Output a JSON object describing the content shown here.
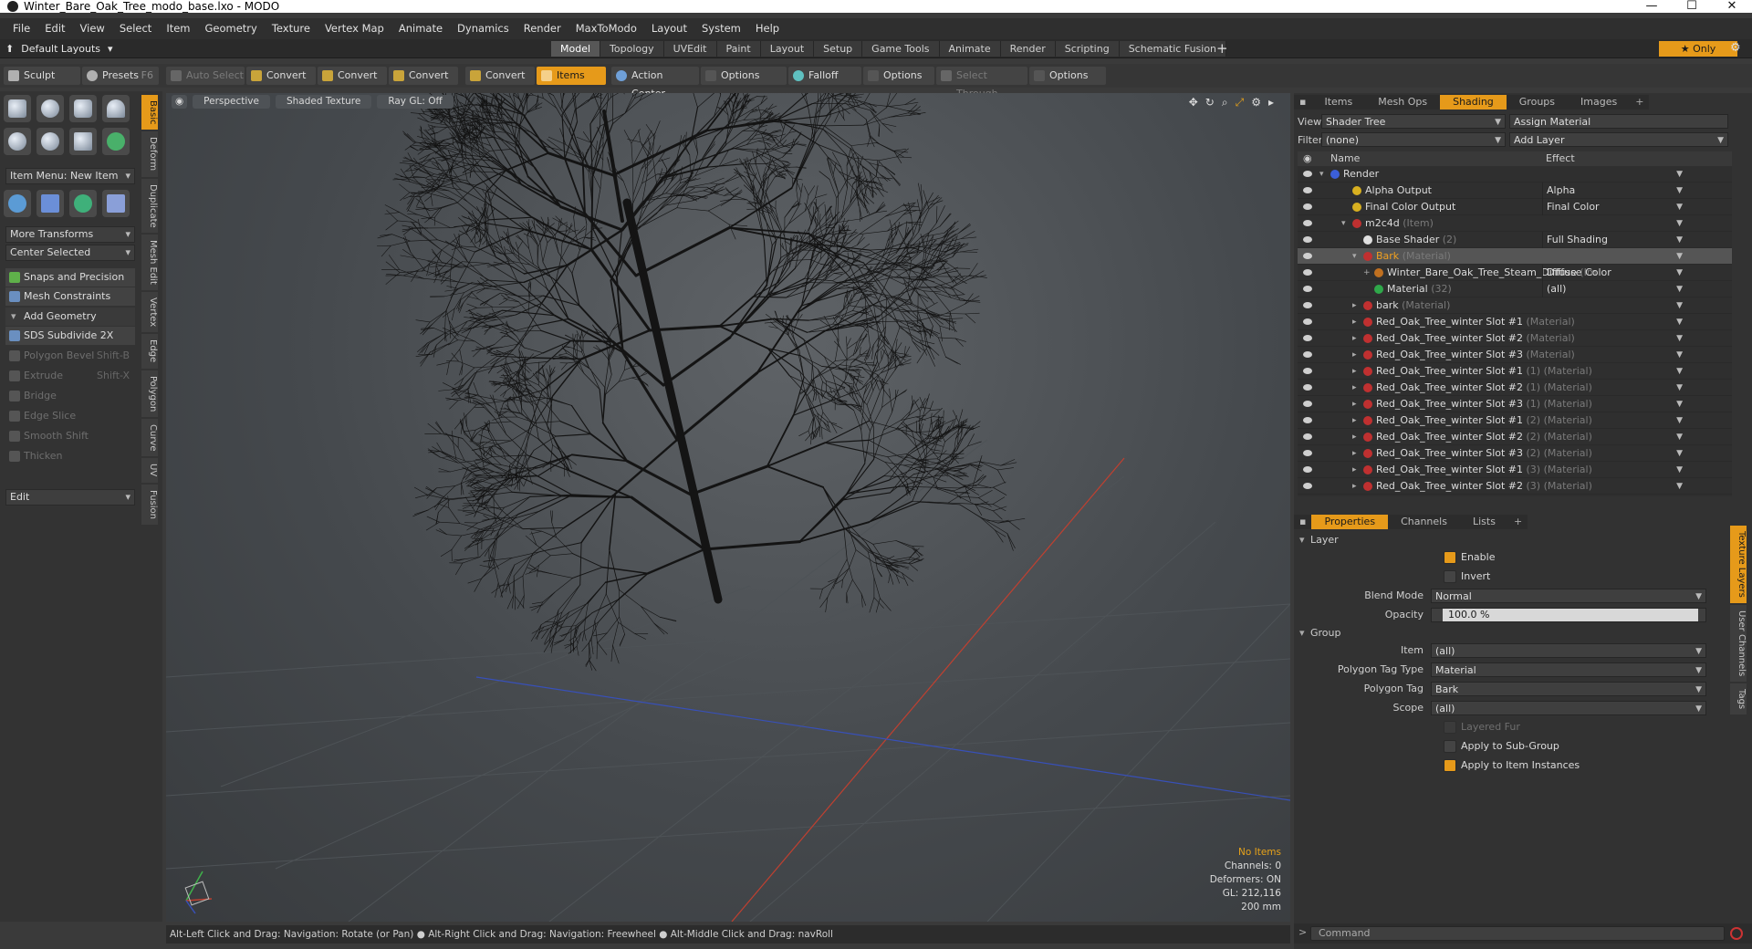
{
  "window": {
    "title": "Winter_Bare_Oak_Tree_modo_base.lxo - MODO"
  },
  "menubar": [
    "File",
    "Edit",
    "View",
    "Select",
    "Item",
    "Geometry",
    "Texture",
    "Vertex Map",
    "Animate",
    "Dynamics",
    "Render",
    "MaxToModo",
    "Layout",
    "System",
    "Help"
  ],
  "layoutbar": {
    "layout_select": "Default Layouts",
    "tabs": [
      "Model",
      "Topology",
      "UVEdit",
      "Paint",
      "Layout",
      "Setup",
      "Game Tools",
      "Animate",
      "Render",
      "Scripting",
      "Schematic Fusion"
    ],
    "active_tab": "Model",
    "only_label": "Only"
  },
  "toolbar": {
    "sculpt": "Sculpt",
    "presets": "Presets",
    "presets_shortcut": "F6",
    "auto_select": "Auto Select",
    "convert": "Convert",
    "items": "Items",
    "action_center": "Action Center",
    "options": "Options",
    "falloff": "Falloff",
    "select_through": "Select Through"
  },
  "leftpanel": {
    "item_menu": "Item Menu: New Item",
    "more_transforms": "More Transforms",
    "center_selected": "Center Selected",
    "snaps": "Snaps and Precision",
    "mesh_constraints": "Mesh Constraints",
    "add_geometry": "Add Geometry",
    "sds": "SDS Subdivide 2X",
    "tools": [
      {
        "label": "Polygon Bevel",
        "shortcut": "Shift-B"
      },
      {
        "label": "Extrude",
        "shortcut": "Shift-X"
      },
      {
        "label": "Bridge",
        "shortcut": ""
      },
      {
        "label": "Edge Slice",
        "shortcut": ""
      },
      {
        "label": "Smooth Shift",
        "shortcut": ""
      },
      {
        "label": "Thicken",
        "shortcut": ""
      }
    ],
    "edit": "Edit",
    "vtabs": [
      "Basic",
      "Deform",
      "Duplicate",
      "Mesh Edit",
      "Vertex",
      "Edge",
      "Polygon",
      "Curve",
      "UV",
      "Fusion"
    ]
  },
  "viewport": {
    "view": "Perspective",
    "shading": "Shaded Texture",
    "raygl": "Ray GL: Off",
    "stats": {
      "no_items": "No Items",
      "channels": "Channels: 0",
      "deformers": "Deformers: ON",
      "gl": "GL: 212,116",
      "scale": "200 mm"
    }
  },
  "statusbar": "Alt-Left Click and Drag: Navigation: Rotate (or Pan) ● Alt-Right Click and Drag: Navigation: Freewheel ● Alt-Middle Click and Drag: navRoll",
  "shader_panel": {
    "tabs": [
      "Items",
      "Mesh Ops",
      "Shading",
      "Groups",
      "Images"
    ],
    "active_tab": "Shading",
    "view_label": "View",
    "view_value": "Shader Tree",
    "assign_material": "Assign Material",
    "filter_label": "Filter",
    "filter_value": "(none)",
    "add_layer": "Add Layer",
    "col_name": "Name",
    "col_effect": "Effect",
    "rows": [
      {
        "name": "Render",
        "kind": "",
        "effect": "",
        "indent": 0,
        "ball": "#3b5fd9",
        "expand": "▾"
      },
      {
        "name": "Alpha Output",
        "kind": "",
        "effect": "Alpha",
        "indent": 2,
        "ball": "#d8b020",
        "expand": ""
      },
      {
        "name": "Final Color Output",
        "kind": "",
        "effect": "Final Color",
        "indent": 2,
        "ball": "#d8b020",
        "expand": ""
      },
      {
        "name": "m2c4d",
        "kind": "(Item)",
        "effect": "",
        "indent": 2,
        "ball": "#c03030",
        "expand": "▾"
      },
      {
        "name": "Base Shader",
        "kind": "(2)",
        "effect": "Full Shading",
        "indent": 3,
        "ball": "#e0e0e0",
        "expand": ""
      },
      {
        "name": "Bark",
        "kind": "(Material)",
        "effect": "",
        "indent": 3,
        "ball": "#c03030",
        "expand": "▾"
      },
      {
        "name": "Winter_Bare_Oak_Tree_Steam_Diffuse",
        "kind": "(Im",
        "effect": "Diffuse Color",
        "indent": 4,
        "ball": "#c07020",
        "expand": "+"
      },
      {
        "name": "Material",
        "kind": "(32)",
        "effect": "(all)",
        "indent": 4,
        "ball": "#2fa84a",
        "expand": ""
      },
      {
        "name": "bark",
        "kind": "(Material)",
        "effect": "",
        "indent": 3,
        "ball": "#c03030",
        "expand": "▸"
      },
      {
        "name": "Red_Oak_Tree_winter Slot #1",
        "kind": "(Material)",
        "effect": "",
        "indent": 3,
        "ball": "#c03030",
        "expand": "▸"
      },
      {
        "name": "Red_Oak_Tree_winter Slot #2",
        "kind": "(Material)",
        "effect": "",
        "indent": 3,
        "ball": "#c03030",
        "expand": "▸"
      },
      {
        "name": "Red_Oak_Tree_winter Slot #3",
        "kind": "(Material)",
        "effect": "",
        "indent": 3,
        "ball": "#c03030",
        "expand": "▸"
      },
      {
        "name": "Red_Oak_Tree_winter Slot #1",
        "kind": "(1) (Material)",
        "effect": "",
        "indent": 3,
        "ball": "#c03030",
        "expand": "▸"
      },
      {
        "name": "Red_Oak_Tree_winter Slot #2",
        "kind": "(1) (Material)",
        "effect": "",
        "indent": 3,
        "ball": "#c03030",
        "expand": "▸"
      },
      {
        "name": "Red_Oak_Tree_winter Slot #3",
        "kind": "(1) (Material)",
        "effect": "",
        "indent": 3,
        "ball": "#c03030",
        "expand": "▸"
      },
      {
        "name": "Red_Oak_Tree_winter Slot #1",
        "kind": "(2) (Material)",
        "effect": "",
        "indent": 3,
        "ball": "#c03030",
        "expand": "▸"
      },
      {
        "name": "Red_Oak_Tree_winter Slot #2",
        "kind": "(2) (Material)",
        "effect": "",
        "indent": 3,
        "ball": "#c03030",
        "expand": "▸"
      },
      {
        "name": "Red_Oak_Tree_winter Slot #3",
        "kind": "(2) (Material)",
        "effect": "",
        "indent": 3,
        "ball": "#c03030",
        "expand": "▸"
      },
      {
        "name": "Red_Oak_Tree_winter Slot #1",
        "kind": "(3) (Material)",
        "effect": "",
        "indent": 3,
        "ball": "#c03030",
        "expand": "▸"
      },
      {
        "name": "Red_Oak_Tree_winter Slot #2",
        "kind": "(3) (Material)",
        "effect": "",
        "indent": 3,
        "ball": "#c03030",
        "expand": "▸"
      }
    ],
    "selected_row": 5
  },
  "properties": {
    "tabs": [
      "Properties",
      "Channels",
      "Lists"
    ],
    "active_tab": "Properties",
    "layer_section": "Layer",
    "enable": "Enable",
    "invert": "Invert",
    "blend_mode_label": "Blend Mode",
    "blend_mode": "Normal",
    "opacity_label": "Opacity",
    "opacity": "100.0 %",
    "opacity_fraction": 1.0,
    "group_section": "Group",
    "item_label": "Item",
    "item_value": "(all)",
    "ptag_type_label": "Polygon Tag Type",
    "ptag_type": "Material",
    "ptag_label": "Polygon Tag",
    "ptag": "Bark",
    "scope_label": "Scope",
    "scope": "(all)",
    "layered_fur": "Layered Fur",
    "apply_subgroup": "Apply to Sub-Group",
    "apply_instances": "Apply to Item Instances",
    "vtabs": [
      "Texture Layers",
      "User Channels",
      "Tags"
    ]
  },
  "command": {
    "placeholder": "Command"
  },
  "colors": {
    "accent": "#e69a1a",
    "viewport": "#45494d",
    "panel": "#323232"
  }
}
